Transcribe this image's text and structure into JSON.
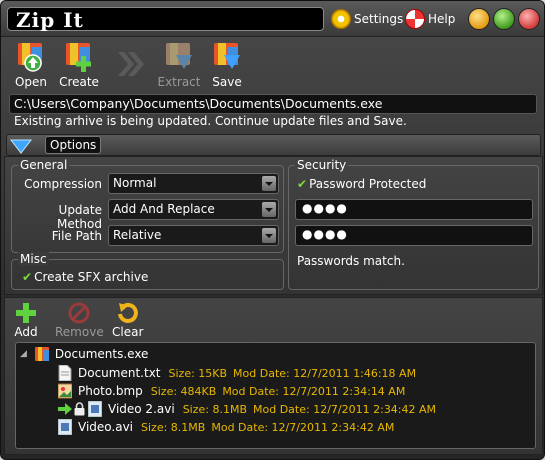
{
  "app": {
    "title": "Zip It",
    "settings_label": "Settings",
    "help_label": "Help"
  },
  "toolbar": {
    "open_label": "Open",
    "create_label": "Create",
    "extract_label": "Extract",
    "save_label": "Save"
  },
  "path": "C:\\Users\\Company\\Documents\\Documents\\Documents.exe",
  "status": "Existing arhive is being updated. Continue update files and Save.",
  "options": {
    "tab_label": "Options",
    "general": {
      "title": "General",
      "compression_label": "Compression",
      "compression_value": "Normal",
      "update_method_label": "Update Method",
      "update_method_value": "Add And Replace",
      "file_path_label": "File Path",
      "file_path_value": "Relative"
    },
    "misc": {
      "title": "Misc",
      "sfx_label": "Create SFX archive"
    },
    "security": {
      "title": "Security",
      "password_protected_label": "Password Protected",
      "password_mask": "●●●●",
      "confirm_mask": "●●●●",
      "match_message": "Passwords match."
    }
  },
  "file_toolbar": {
    "add_label": "Add",
    "remove_label": "Remove",
    "clear_label": "Clear"
  },
  "tree": {
    "root": "Documents.exe",
    "files": [
      {
        "name": "Document.txt",
        "size": "Size:  15KB",
        "mod": "Mod Date: 12/7/2011 1:46:18 AM"
      },
      {
        "name": "Photo.bmp",
        "size": "Size:  484KB",
        "mod": "Mod Date: 12/7/2011 2:34:14 AM"
      },
      {
        "name": "Video 2.avi",
        "size": "Size:  8.1MB",
        "mod": "Mod Date: 12/7/2011 2:34:42 AM"
      },
      {
        "name": "Video.avi",
        "size": "Size:  8.1MB",
        "mod": "Mod Date: 12/7/2011 2:34:42 AM"
      }
    ]
  },
  "colors": {
    "accent_yellow": "#e6b800",
    "check_green": "#7fd93d"
  }
}
